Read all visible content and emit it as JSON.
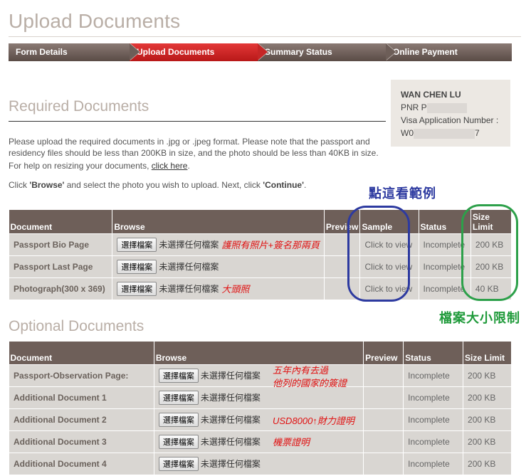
{
  "page_title": "Upload Documents",
  "steps": [
    {
      "label": "Form Details",
      "active": false
    },
    {
      "label": "Upload Documents",
      "active": true
    },
    {
      "label": "Summary Status",
      "active": false
    },
    {
      "label": "Online Payment",
      "active": false
    }
  ],
  "applicant": {
    "name": "WAN CHEN LU",
    "pnr_label": "PNR P",
    "visa_label": "Visa Application Number :",
    "visa_prefix": "W0",
    "visa_suffix": "7"
  },
  "required": {
    "title": "Required Documents",
    "instructions": "Please upload the required documents in .jpg or .jpeg format. Please note that the passport and residency files should be less than 200KB in size, and the photo should be less than 40KB in size.",
    "help_prefix": "For help on resizing your documents, ",
    "help_link": "click here",
    "help_suffix": ".",
    "click_prefix": "Click ",
    "browse_word": "'Browse'",
    "click_middle": " and select the photo you wish to upload. Next, click ",
    "continue_word": "'Continue'",
    "click_suffix": ".",
    "columns": [
      "Document",
      "Browse",
      "Preview",
      "Sample",
      "Status",
      "Size Limit"
    ],
    "rows": [
      {
        "document": "Passport Bio Page",
        "button": "選擇檔案",
        "file": "未選擇任何檔案",
        "note": "護照有照片+簽名那兩頁",
        "sample": "Click to view",
        "status": "Incomplete",
        "size": "200 KB"
      },
      {
        "document": "Passport Last Page",
        "button": "選擇檔案",
        "file": "未選擇任何檔案",
        "note": "",
        "sample": "Click to view",
        "status": "Incomplete",
        "size": "200 KB"
      },
      {
        "document": "Photograph(300 x 369)",
        "button": "選擇檔案",
        "file": "未選擇任何檔案",
        "note": "大頭照",
        "sample": "Click to view",
        "status": "Incomplete",
        "size": "40 KB"
      }
    ]
  },
  "optional": {
    "title": "Optional Documents",
    "columns": [
      "Document",
      "Browse",
      "Preview",
      "Status",
      "Size Limit"
    ],
    "rows": [
      {
        "document": "Passport-Observation Page:",
        "button": "選擇檔案",
        "file": "未選擇任何檔案",
        "status": "Incomplete",
        "size": "200 KB"
      },
      {
        "document": "Additional Document 1",
        "button": "選擇檔案",
        "file": "未選擇任何檔案",
        "status": "Incomplete",
        "size": "200 KB"
      },
      {
        "document": "Additional Document 2",
        "button": "選擇檔案",
        "file": "未選擇任何檔案",
        "status": "Incomplete",
        "size": "200 KB"
      },
      {
        "document": "Additional Document 3",
        "button": "選擇檔案",
        "file": "未選擇任何檔案",
        "status": "Incomplete",
        "size": "200 KB"
      },
      {
        "document": "Additional Document 4",
        "button": "選擇檔案",
        "file": "未選擇任何檔案",
        "status": "Incomplete",
        "size": "200 KB"
      }
    ],
    "notes": {
      "observation_line1": "五年內有去過",
      "observation_line2": "他列的國家的簽證",
      "doc2": "USD8000↑財力證明",
      "doc3": "機票證明"
    }
  },
  "annotations": {
    "sample_hint": "點這看範例",
    "size_hint": "檔案大小限制",
    "colors": {
      "blue": "#2d3aa0",
      "green": "#2da04a",
      "red": "#e01010"
    }
  }
}
